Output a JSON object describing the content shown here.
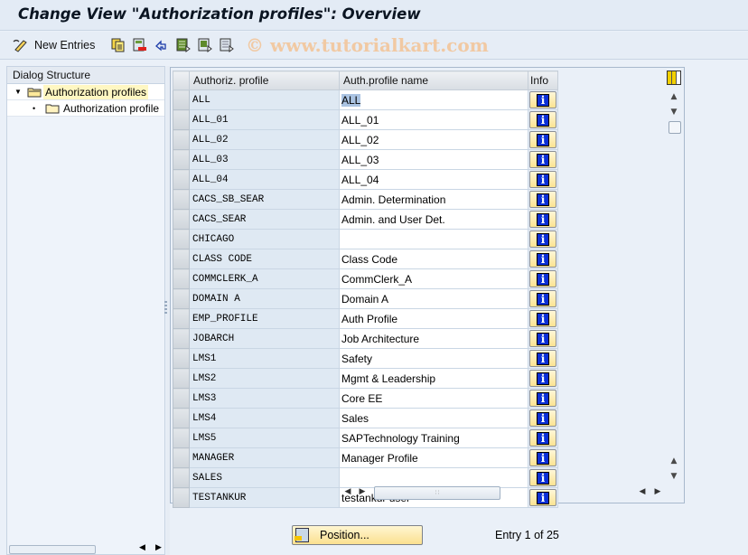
{
  "window": {
    "title": "Change View \"Authorization profiles\": Overview"
  },
  "toolbar": {
    "new_entries_label": "New Entries",
    "icons": [
      "change-display-icon",
      "copy-as-icon",
      "delete-icon",
      "undo-change-icon",
      "select-all-icon",
      "select-block-icon",
      "deselect-all-icon"
    ],
    "watermark": "© www.tutorialkart.com"
  },
  "dialog_structure": {
    "header": "Dialog Structure",
    "items": [
      {
        "label": "Authorization profiles",
        "level": 0,
        "expanded": true,
        "selected": true
      },
      {
        "label": "Authorization profile",
        "level": 1,
        "expanded": false,
        "selected": false
      }
    ]
  },
  "table": {
    "columns": [
      "Authoriz. profile",
      "Auth.profile name",
      "Info"
    ],
    "rows": [
      {
        "profile": "ALL",
        "name": "ALL"
      },
      {
        "profile": "ALL_01",
        "name": "ALL_01"
      },
      {
        "profile": "ALL_02",
        "name": "ALL_02"
      },
      {
        "profile": "ALL_03",
        "name": "ALL_03"
      },
      {
        "profile": "ALL_04",
        "name": "ALL_04"
      },
      {
        "profile": "CACS_SB_SEAR",
        "name": "Admin. Determination"
      },
      {
        "profile": "CACS_SEAR",
        "name": "Admin. and User Det."
      },
      {
        "profile": "CHICAGO",
        "name": ""
      },
      {
        "profile": "CLASS CODE",
        "name": "Class Code"
      },
      {
        "profile": "COMMCLERK_A",
        "name": "CommClerk_A"
      },
      {
        "profile": "DOMAIN A",
        "name": "Domain A"
      },
      {
        "profile": "EMP_PROFILE",
        "name": "Auth Profile"
      },
      {
        "profile": "JOBARCH",
        "name": "Job Architecture"
      },
      {
        "profile": "LMS1",
        "name": "Safety"
      },
      {
        "profile": "LMS2",
        "name": "Mgmt & Leadership"
      },
      {
        "profile": "LMS3",
        "name": "Core EE"
      },
      {
        "profile": "LMS4",
        "name": "Sales"
      },
      {
        "profile": "LMS5",
        "name": "SAPTechnology Training"
      },
      {
        "profile": "MANAGER",
        "name": "Manager Profile"
      },
      {
        "profile": "SALES",
        "name": ""
      },
      {
        "profile": "TESTANKUR",
        "name": "testankur user"
      }
    ],
    "info_glyph": "i"
  },
  "footer": {
    "position_label": "Position...",
    "entry_text": "Entry 1 of 25"
  }
}
